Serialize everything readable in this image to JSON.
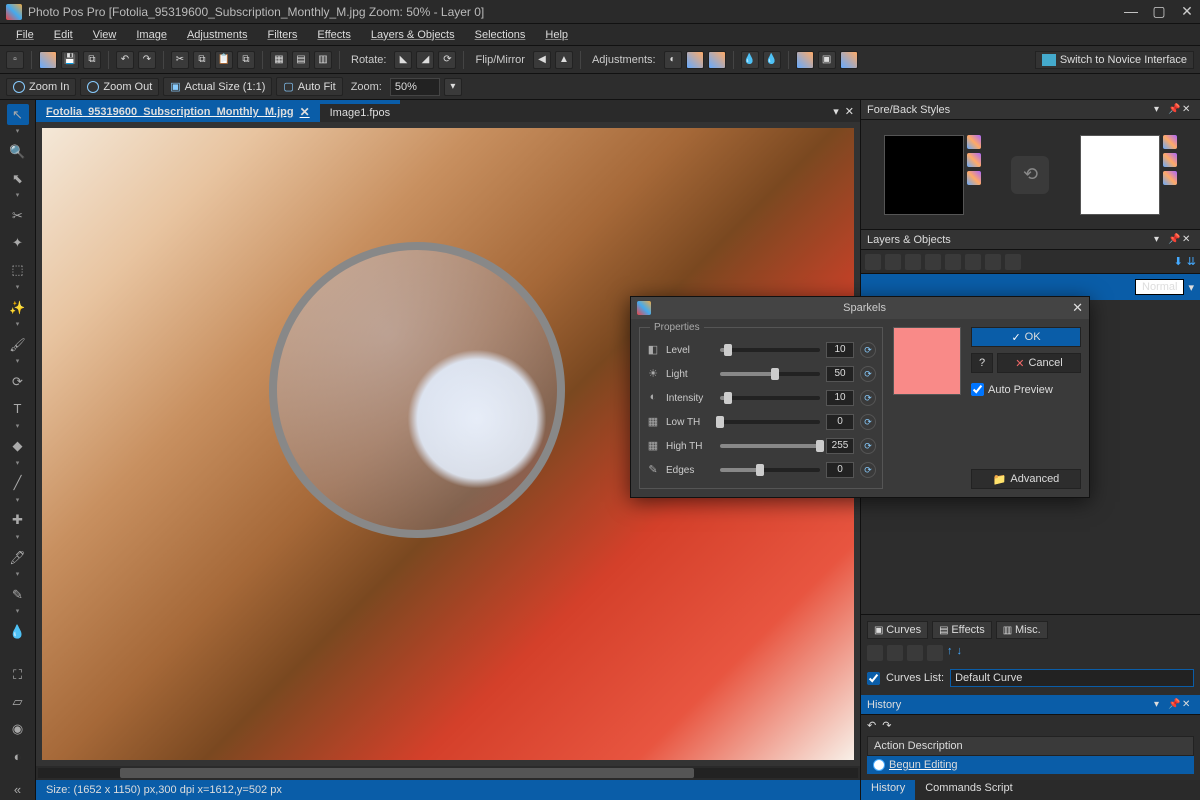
{
  "titlebar": {
    "title": "Photo Pos Pro [Fotolia_95319600_Subscription_Monthly_M.jpg Zoom: 50% - Layer 0]"
  },
  "menu": [
    "File",
    "Edit",
    "View",
    "Image",
    "Adjustments",
    "Filters",
    "Effects",
    "Layers & Objects",
    "Selections",
    "Help"
  ],
  "toolbar": {
    "rotate": "Rotate:",
    "flip": "Flip/Mirror",
    "adjust": "Adjustments:",
    "novice": "Switch to Novice Interface"
  },
  "zoom": {
    "in": "Zoom In",
    "out": "Zoom Out",
    "actual": "Actual Size (1:1)",
    "autofit": "Auto Fit",
    "label": "Zoom:",
    "value": "50%"
  },
  "tabs": [
    {
      "label": "Fotolia_95319600_Subscription_Monthly_M.jpg",
      "active": true
    },
    {
      "label": "Image1.fpos",
      "active": false
    }
  ],
  "status": "Size: (1652 x 1150) px,300 dpi   x=1612,y=502 px",
  "panels": {
    "foreback": "Fore/Back Styles",
    "layers": "Layers & Objects",
    "history": "History"
  },
  "curves": {
    "tabs": [
      "Curves",
      "Effects",
      "Misc."
    ],
    "listLabel": "Curves List:",
    "default": "Default Curve"
  },
  "history": {
    "header": "Action Description",
    "item": "Begun Editing",
    "bottomTabs": [
      "History",
      "Commands Script"
    ]
  },
  "layerrow": {
    "mode": "Normal"
  },
  "dialog": {
    "title": "Sparkels",
    "groupLabel": "Properties",
    "props": [
      {
        "icon": "◧",
        "label": "Level",
        "val": "10",
        "pct": 8
      },
      {
        "icon": "☀",
        "label": "Light",
        "val": "50",
        "pct": 55
      },
      {
        "icon": "◐",
        "label": "Intensity",
        "val": "10",
        "pct": 8
      },
      {
        "icon": "▦",
        "label": "Low TH",
        "val": "0",
        "pct": 0
      },
      {
        "icon": "▦",
        "label": "High TH",
        "val": "255",
        "pct": 100
      },
      {
        "icon": "✎",
        "label": "Edges",
        "val": "0",
        "pct": 40
      }
    ],
    "ok": "OK",
    "cancel": "Cancel",
    "autoPreview": "Auto Preview",
    "advanced": "Advanced"
  }
}
